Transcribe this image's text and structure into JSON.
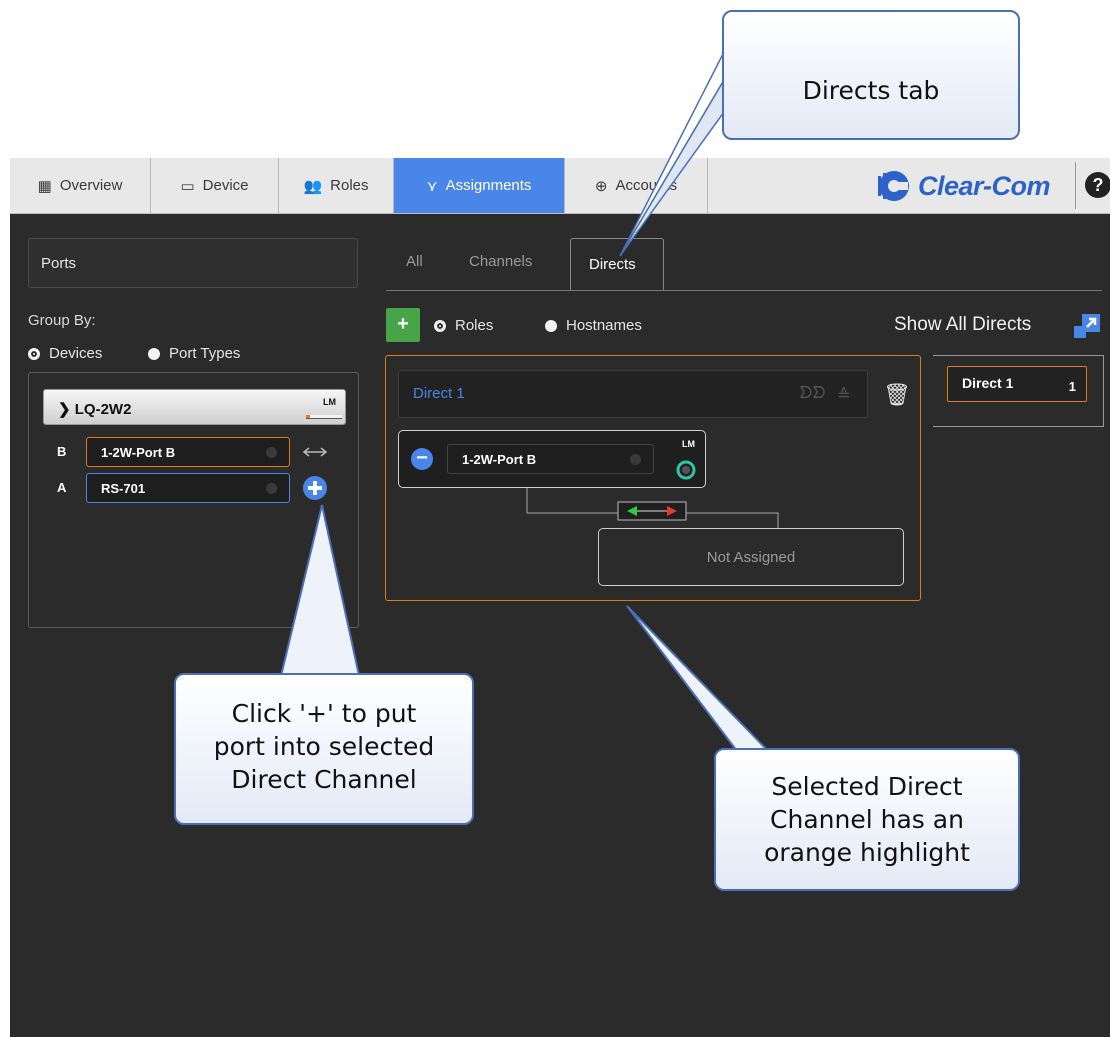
{
  "navbar": {
    "tabs": [
      {
        "label": "Overview",
        "icon": "grid-icon"
      },
      {
        "label": "Device",
        "icon": "device-icon"
      },
      {
        "label": "Roles",
        "icon": "roles-icon"
      },
      {
        "label": "Assignments",
        "icon": "assignments-icon"
      },
      {
        "label": "Accounts",
        "icon": "accounts-icon"
      }
    ],
    "active_tab": "Assignments",
    "logo_text": "Clear-Com",
    "help_label": "?"
  },
  "left_panel": {
    "ports_title": "Ports",
    "group_by_label": "Group By:",
    "group_by_options": [
      "Devices",
      "Port Types"
    ],
    "group_by_selected": "Devices",
    "device": {
      "name": "LQ-2W2",
      "badge": "LM",
      "ports": [
        {
          "letter": "B",
          "name": "1-2W-Port B",
          "state": "assigned"
        },
        {
          "letter": "A",
          "name": "RS-701",
          "state": "available"
        }
      ]
    }
  },
  "main": {
    "subtabs": [
      "All",
      "Channels",
      "Directs"
    ],
    "active_subtab": "Directs",
    "add_label": "+",
    "list_by_options": [
      "Roles",
      "Hostnames"
    ],
    "list_by_selected": "Roles",
    "show_all_label": "Show All Directs",
    "direct": {
      "title": "Direct 1",
      "port": {
        "name": "1-2W-Port B",
        "badge": "LM"
      },
      "unassigned_label": "Not Assigned"
    },
    "direct_list": [
      {
        "label": "Direct 1",
        "count": "1"
      }
    ]
  },
  "callouts": {
    "directs_tab": "Directs tab",
    "click_plus": [
      "Click '+' to put",
      "port into selected",
      "Direct Channel"
    ],
    "selected_highlight": [
      "Selected Direct",
      "Channel has an",
      "orange highlight"
    ]
  },
  "colors": {
    "accent": "#4a86e8",
    "highlight": "#e07b16",
    "add": "#47a447",
    "background": "#2b2b2b"
  }
}
